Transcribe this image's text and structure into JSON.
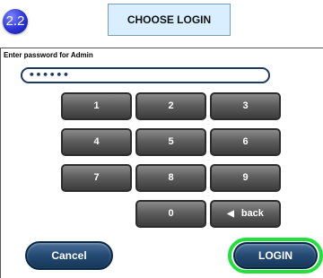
{
  "step": "2.2",
  "title": "CHOOSE LOGIN",
  "prompt": "Enter password for Admin",
  "password": "••••••",
  "keys": {
    "k1": "1",
    "k2": "2",
    "k3": "3",
    "k4": "4",
    "k5": "5",
    "k6": "6",
    "k7": "7",
    "k8": "8",
    "k9": "9",
    "k0": "0",
    "back": "back"
  },
  "buttons": {
    "cancel": "Cancel",
    "login": "LOGIN"
  },
  "colors": {
    "highlight": "#22e03a",
    "button": "#244a73"
  }
}
